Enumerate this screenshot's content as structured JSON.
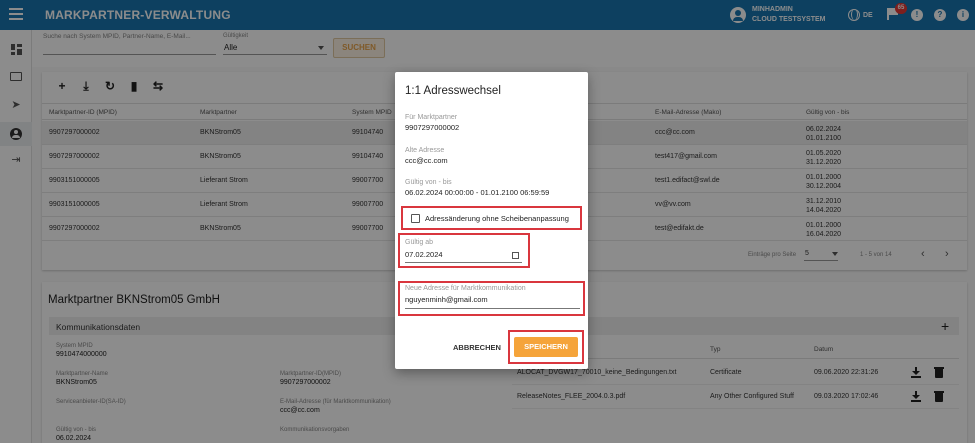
{
  "header": {
    "title": "MARKPARTNER-VERWALTUNG",
    "user_name": "MINHADMIN",
    "user_system": "CLOUD TESTSYSTEM",
    "language": "DE",
    "notification_count": "65",
    "icons": [
      "menu-icon",
      "account-icon",
      "globe-icon",
      "flag-icon",
      "alert-icon",
      "help-icon",
      "info-icon"
    ]
  },
  "sidenav": {
    "items": [
      "dashboard-icon",
      "messages-icon",
      "send-icon",
      "account-icon",
      "logout-icon"
    ],
    "active_index": 3
  },
  "search": {
    "placeholder": "Suche nach System MPID, Partner-Name, E-Mail...",
    "validity_label": "Gültigkeit",
    "validity_value": "Alle",
    "button": "SUCHEN"
  },
  "table": {
    "toolbar_icons": [
      "add-icon",
      "download-icon",
      "sync-icon",
      "delete-icon",
      "swap-icon"
    ],
    "headers": [
      "Marktpartner-ID (MPID)",
      "Marktpartner",
      "System MPID",
      "E-Mail-Adresse (Mako)",
      "Gültig von - bis"
    ],
    "rows": [
      {
        "mpid": "9907297000002",
        "partner": "BKNStrom05",
        "system": "99104740",
        "email": "ccc@cc.com",
        "from": "06.02.2024",
        "to": "01.01.2100",
        "selected": true
      },
      {
        "mpid": "9907297000002",
        "partner": "BKNStrom05",
        "system": "99104740",
        "email": "test417@gmail.com",
        "from": "01.05.2020",
        "to": "31.12.2020",
        "selected": false
      },
      {
        "mpid": "9903151000005",
        "partner": "Lieferant Strom",
        "system": "99007700",
        "email": "test1.edifact@swl.de",
        "from": "01.01.2000",
        "to": "30.12.2004",
        "selected": false
      },
      {
        "mpid": "9903151000005",
        "partner": "Lieferant Strom",
        "system": "99007700",
        "email": "vv@vv.com",
        "from": "31.12.2010",
        "to": "14.04.2020",
        "selected": false
      },
      {
        "mpid": "9907297000002",
        "partner": "BKNStrom05",
        "system": "99007700",
        "email": "test@edifakt.de",
        "from": "01.01.2000",
        "to": "16.04.2020",
        "selected": false
      }
    ],
    "pager": {
      "label": "Einträge pro Seite",
      "per_page": "5",
      "range": "1 - 5 von 14"
    }
  },
  "detail": {
    "title": "Marktpartner BKNStrom05 GmbH",
    "section": "Kommunikationsdaten",
    "fields": {
      "system_mpid": {
        "label": "System MPID",
        "value": "9910474000000"
      },
      "partner_name": {
        "label": "Marktpartner-Name",
        "value": "BKNStrom05"
      },
      "partner_id": {
        "label": "Marktpartner-ID(MPID)",
        "value": "9907297000002"
      },
      "provider_id": {
        "label": "Serviceanbieter-ID(SA-ID)",
        "value": ""
      },
      "email": {
        "label": "E-Mail-Adresse (für Marktkommunikation)",
        "value": "ccc@cc.com"
      },
      "valid": {
        "label": "Gültig von - bis",
        "value": "06.02.2024"
      },
      "requirements": {
        "label": "Kommunikationsvorgaben",
        "value": ""
      }
    },
    "files": {
      "headers": [
        "Typ",
        "Datum"
      ],
      "rows": [
        {
          "name": "ALOCAT_DVGW17_70010_keine_Bedingungen.txt",
          "type": "Certificate",
          "date": "09.06.2020 22:31:26"
        },
        {
          "name": "ReleaseNotes_FLEE_2004.0.3.pdf",
          "type": "Any Other Configured Stuff",
          "date": "09.03.2020 17:02:46"
        }
      ]
    }
  },
  "dialog": {
    "title": "1:1 Adresswechsel",
    "partner_label": "Für Marktpartner",
    "partner_value": "9907297000002",
    "old_address_label": "Alte Adresse",
    "old_address_value": "ccc@cc.com",
    "valid_label": "Gültig von - bis",
    "valid_value": "06.02.2024 00:00:00 - 01.01.2100 06:59:59",
    "checkbox_label": "Adressänderung ohne Scheibenanpassung",
    "checkbox_checked": false,
    "valid_from_label": "Gültig ab",
    "valid_from_value": "07.02.2024",
    "new_address_label": "Neue Adresse für Marktkommunikation",
    "new_address_value": "nguyenminh@gmail.com",
    "cancel": "ABBRECHEN",
    "save": "SPEICHERN"
  },
  "colors": {
    "primary": "#1976b0",
    "accent": "#f5a43a",
    "highlight": "#d9363e"
  }
}
